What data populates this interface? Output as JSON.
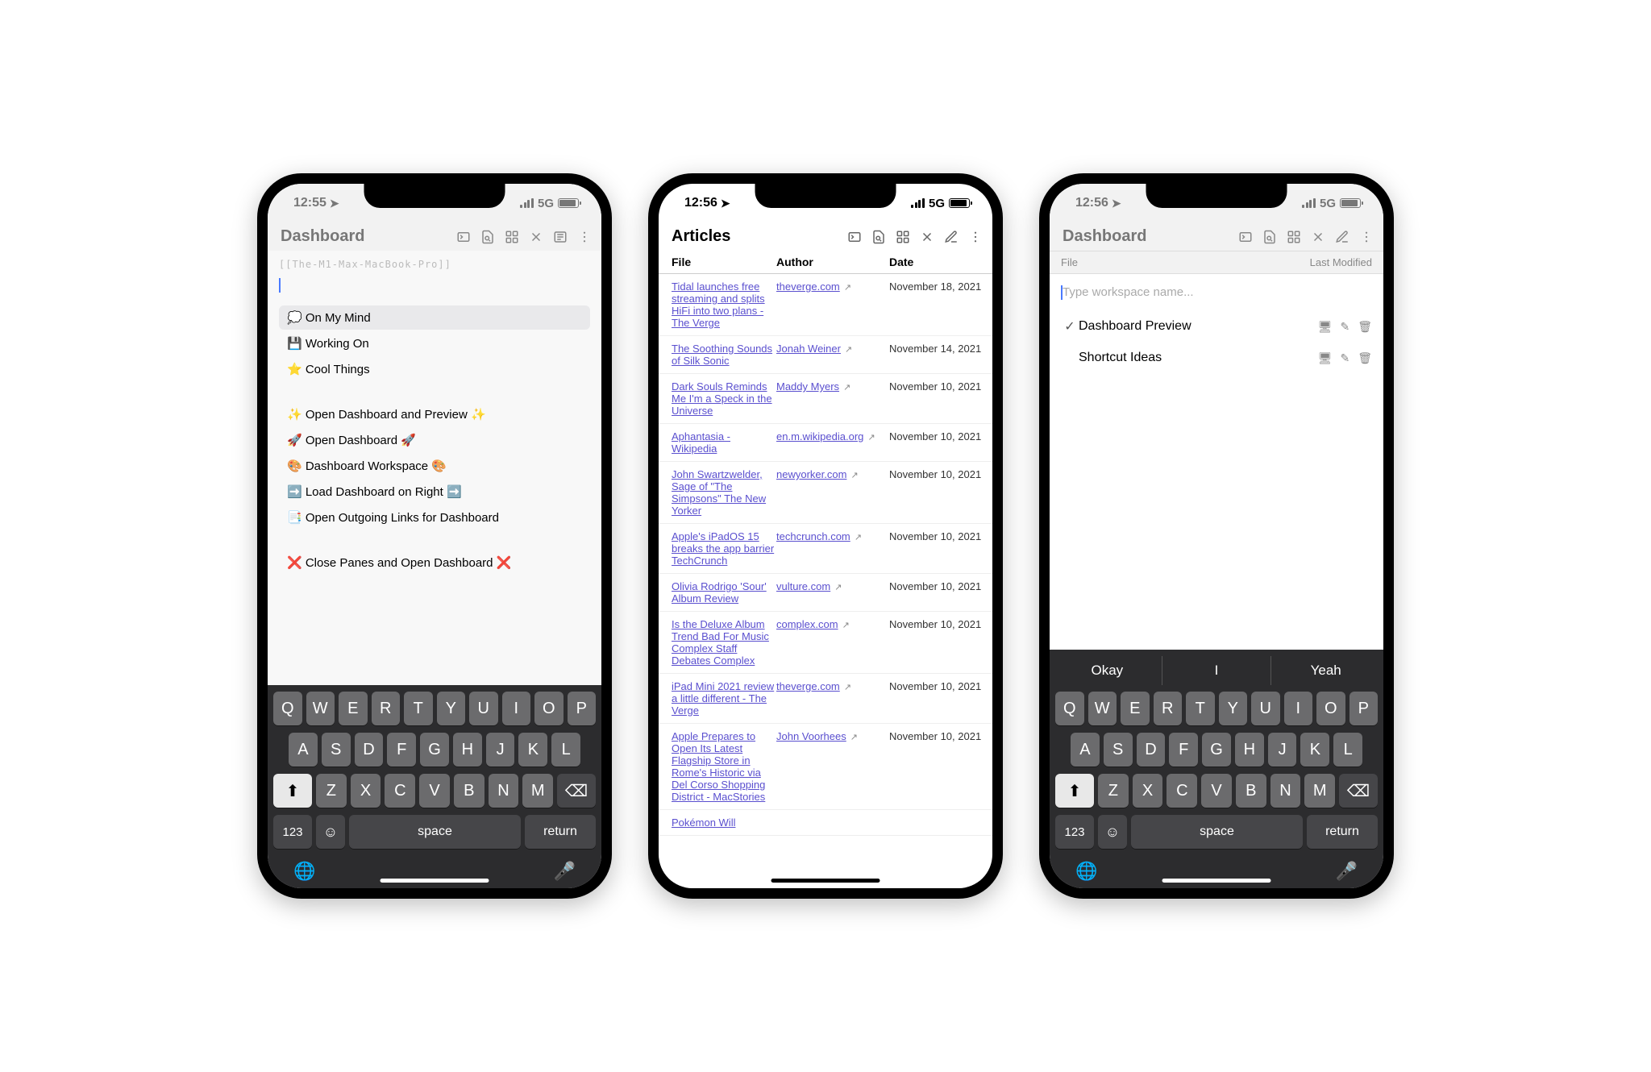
{
  "phone1": {
    "time": "12:55",
    "net": "5G",
    "title": "Dashboard",
    "hint": "[[The-M1-Max-MacBook-Pro]]",
    "menu": [
      {
        "label": "💭 On My Mind",
        "sel": true
      },
      {
        "label": "💾 Working On"
      },
      {
        "label": "⭐ Cool Things"
      }
    ],
    "actions": [
      "✨ Open Dashboard and Preview ✨",
      "🚀 Open Dashboard 🚀",
      "🎨 Dashboard Workspace 🎨",
      "➡️ Load Dashboard on Right ➡️",
      "📑 Open Outgoing Links for Dashboard"
    ],
    "close": "❌ Close Panes and Open Dashboard ❌"
  },
  "phone2": {
    "time": "12:56",
    "net": "5G",
    "title": "Articles",
    "cols": {
      "file": "File",
      "author": "Author",
      "date": "Date"
    },
    "rows": [
      {
        "file": "Tidal launches free streaming and splits HiFi into two plans - The Verge",
        "author": "theverge.com",
        "date": "November 18, 2021"
      },
      {
        "file": "The Soothing Sounds of Silk Sonic",
        "author": "Jonah Weiner",
        "date": "November 14, 2021"
      },
      {
        "file": "Dark Souls Reminds Me I'm a Speck in the Universe",
        "author": "Maddy Myers",
        "date": "November 10, 2021"
      },
      {
        "file": "Aphantasia - Wikipedia",
        "author": "en.m.wikipedia.org",
        "date": "November 10, 2021"
      },
      {
        "file": "John Swartzwelder, Sage of \"The Simpsons\" The New Yorker",
        "author": "newyorker.com",
        "date": "November 10, 2021"
      },
      {
        "file": "Apple's iPadOS 15 breaks the app barrier TechCrunch",
        "author": "techcrunch.com",
        "date": "November 10, 2021"
      },
      {
        "file": "Olivia Rodrigo 'Sour' Album Review",
        "author": "vulture.com",
        "date": "November 10, 2021"
      },
      {
        "file": "Is the Deluxe Album Trend Bad For Music Complex Staff Debates Complex",
        "author": "complex.com",
        "date": "November 10, 2021"
      },
      {
        "file": "iPad Mini 2021 review a little different - The Verge",
        "author": "theverge.com",
        "date": "November 10, 2021"
      },
      {
        "file": "Apple Prepares to Open Its Latest Flagship Store in Rome's Historic via Del Corso Shopping District - MacStories",
        "author": "John Voorhees",
        "date": "November 10, 2021"
      },
      {
        "file": "Pokémon Will",
        "author": "",
        "date": ""
      }
    ]
  },
  "phone3": {
    "time": "12:56",
    "net": "5G",
    "title": "Dashboard",
    "subhead": {
      "file": "File",
      "mod": "Last Modified"
    },
    "placeholder": "Type workspace name...",
    "items": [
      {
        "name": "Dashboard Preview",
        "active": true
      },
      {
        "name": "Shortcut Ideas",
        "active": false
      }
    ],
    "sugg": [
      "Okay",
      "I",
      "Yeah"
    ]
  },
  "kb": {
    "r1": [
      "Q",
      "W",
      "E",
      "R",
      "T",
      "Y",
      "U",
      "I",
      "O",
      "P"
    ],
    "r2": [
      "A",
      "S",
      "D",
      "F",
      "G",
      "H",
      "J",
      "K",
      "L"
    ],
    "r3": [
      "Z",
      "X",
      "C",
      "V",
      "B",
      "N",
      "M"
    ],
    "num": "123",
    "space": "space",
    "ret": "return"
  }
}
